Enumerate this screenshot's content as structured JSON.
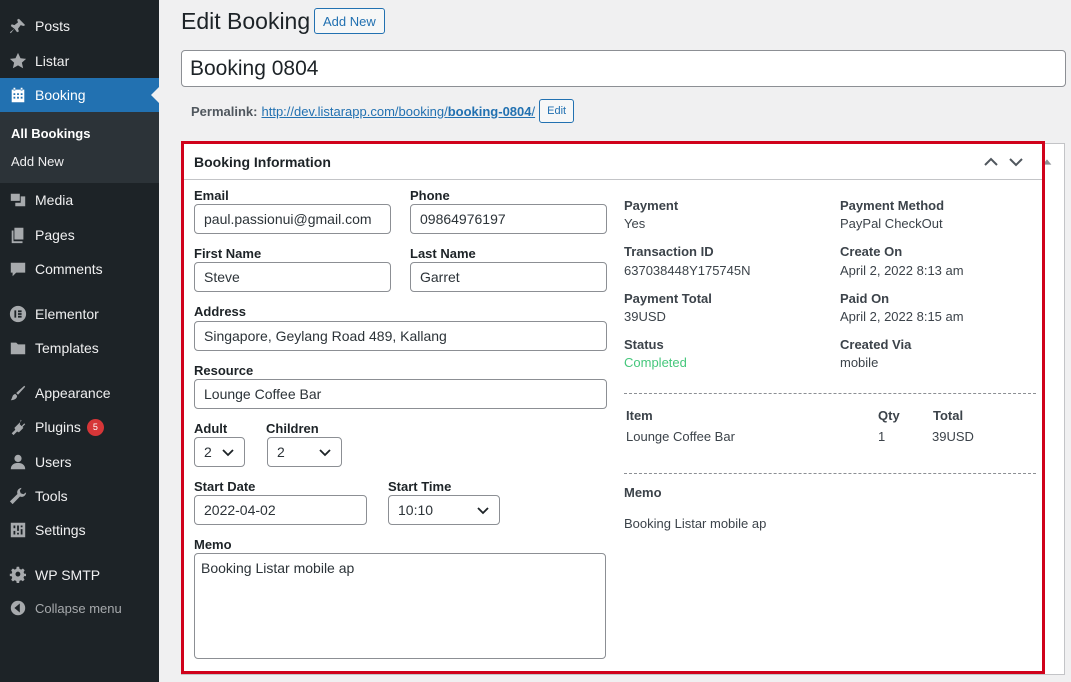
{
  "sidebar": {
    "items": [
      {
        "label": "Posts",
        "icon": "pushpin-icon"
      },
      {
        "label": "Listar",
        "icon": "star-icon"
      },
      {
        "label": "Booking",
        "icon": "calendar-icon"
      },
      {
        "label": "Media",
        "icon": "media-icon"
      },
      {
        "label": "Pages",
        "icon": "pages-icon"
      },
      {
        "label": "Comments",
        "icon": "comment-icon"
      },
      {
        "label": "Elementor",
        "icon": "elementor-icon"
      },
      {
        "label": "Templates",
        "icon": "folder-icon"
      },
      {
        "label": "Appearance",
        "icon": "brush-icon"
      },
      {
        "label": "Plugins",
        "icon": "plug-icon",
        "badge": "5"
      },
      {
        "label": "Users",
        "icon": "user-icon"
      },
      {
        "label": "Tools",
        "icon": "wrench-icon"
      },
      {
        "label": "Settings",
        "icon": "settings-icon"
      },
      {
        "label": "WP SMTP",
        "icon": "gear-icon"
      }
    ],
    "submenu": [
      "All Bookings",
      "Add New"
    ],
    "collapse_label": "Collapse menu"
  },
  "header": {
    "title": "Edit Booking",
    "add_new_label": "Add New"
  },
  "post_title": "Booking 0804",
  "permalink": {
    "label": "Permalink:",
    "url_base": "http://dev.listarapp.com/booking/",
    "slug": "booking-0804",
    "trailing": "/",
    "edit_label": "Edit"
  },
  "postbox": {
    "title": "Booking Information"
  },
  "form": {
    "email_label": "Email",
    "email": "paul.passionui@gmail.com",
    "phone_label": "Phone",
    "phone": "09864976197",
    "first_name_label": "First Name",
    "first_name": "Steve",
    "last_name_label": "Last Name",
    "last_name": "Garret",
    "address_label": "Address",
    "address": "Singapore, Geylang Road 489, Kallang",
    "resource_label": "Resource",
    "resource": "Lounge Coffee Bar",
    "adult_label": "Adult",
    "adult": "2",
    "children_label": "Children",
    "children": "2",
    "start_date_label": "Start Date",
    "start_date": "2022-04-02",
    "start_time_label": "Start Time",
    "start_time": "10:10",
    "memo_label": "Memo",
    "memo": "Booking Listar mobile ap"
  },
  "info": {
    "payment_label": "Payment",
    "payment": "Yes",
    "payment_method_label": "Payment Method",
    "payment_method": "PayPal CheckOut",
    "transaction_label": "Transaction ID",
    "transaction": "637038448Y175745N",
    "create_on_label": "Create On",
    "create_on": "April 2, 2022 8:13 am",
    "payment_total_label": "Payment Total",
    "payment_total": "39USD",
    "paid_on_label": "Paid On",
    "paid_on": "April 2, 2022 8:15 am",
    "status_label": "Status",
    "status": "Completed",
    "created_via_label": "Created Via",
    "created_via": "mobile"
  },
  "items_table": {
    "headers": [
      "Item",
      "Qty",
      "Total"
    ],
    "rows": [
      [
        "Lounge Coffee Bar",
        "1",
        "39USD"
      ]
    ]
  },
  "memo_section": {
    "label": "Memo",
    "value": "Booking Listar mobile ap"
  },
  "colors": {
    "sidebar_bg": "#1d2327",
    "active_blue": "#2271b1",
    "highlight_red": "#d0021b",
    "status_green": "#46c77c"
  }
}
